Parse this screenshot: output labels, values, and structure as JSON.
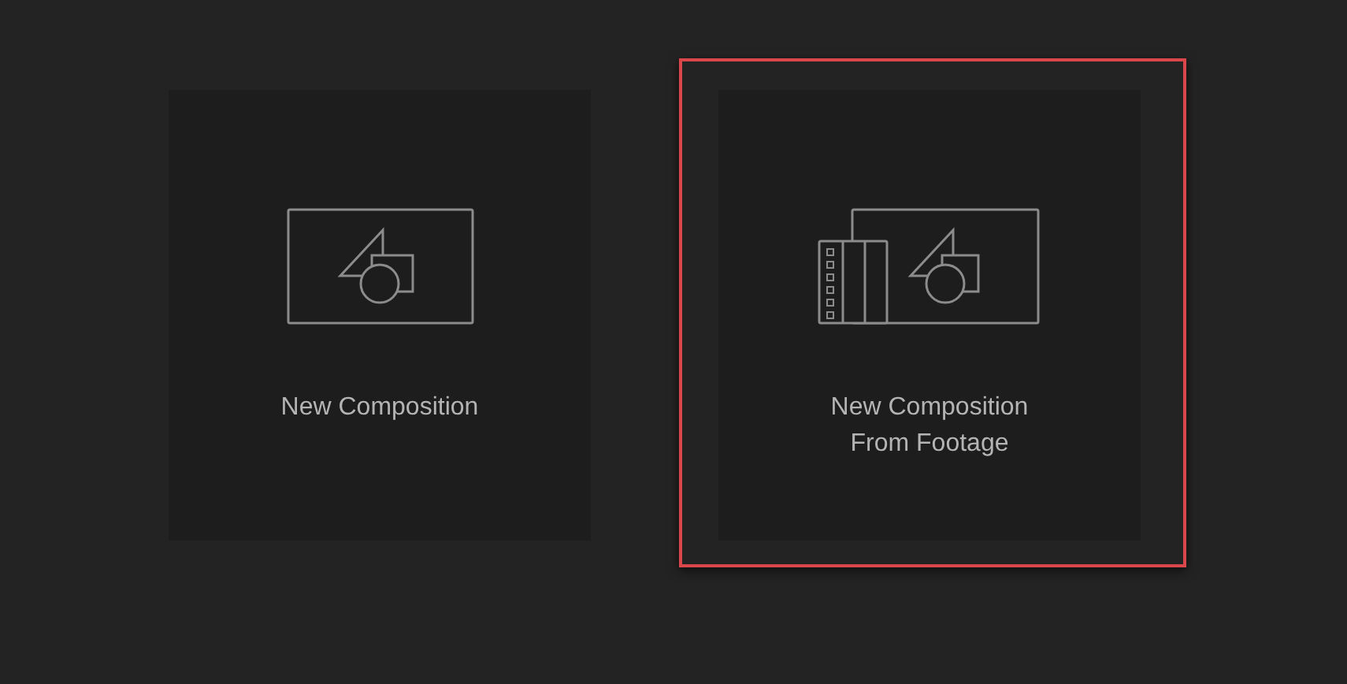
{
  "cards": [
    {
      "kind": "composition",
      "label": "New Composition",
      "selected": false
    },
    {
      "kind": "footage",
      "label": "New Composition\nFrom Footage",
      "selected": true
    }
  ]
}
